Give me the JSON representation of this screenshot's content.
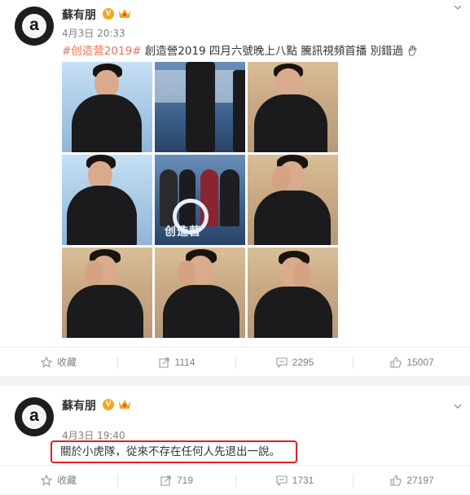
{
  "posts": [
    {
      "user": {
        "avatar_letter": "a",
        "name": "蘇有朋",
        "verified_mark": "V"
      },
      "meta": "4月3日 20:33",
      "hashtag": "#创造营2019#",
      "text": " 創造營2019 四月六號晚上八點 騰訊視頻首播 別錯過",
      "image_overlay_text": "创造营",
      "actions": {
        "favorite": "收藏",
        "repost": "1114",
        "comment": "2295",
        "like": "15007"
      }
    },
    {
      "user": {
        "avatar_letter": "a",
        "name": "蘇有朋",
        "verified_mark": "V"
      },
      "meta": "4月3日 19:40",
      "text": "關於小虎隊，從來不存在任何人先退出一說。",
      "actions": {
        "favorite": "收藏",
        "repost": "719",
        "comment": "1731",
        "like": "27197"
      }
    }
  ],
  "colors": {
    "hashtag": "#eb7350",
    "verified_badge": "#f4a623",
    "highlight_border": "#e41e1e"
  },
  "icons": [
    "star-icon",
    "repost-icon",
    "comment-icon",
    "like-icon",
    "chevron-down-icon",
    "crown-icon",
    "verified-icon",
    "hand-emoji-icon"
  ]
}
